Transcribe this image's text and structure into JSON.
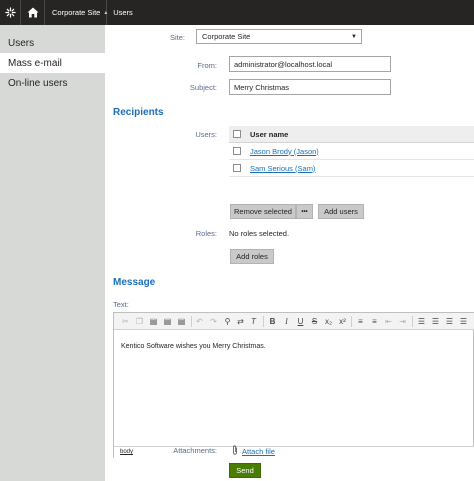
{
  "topbar": {
    "site_selector": "Corporate Site",
    "app_name": "Users"
  },
  "sidebar": {
    "items": [
      {
        "label": "Users"
      },
      {
        "label": "Mass e-mail"
      },
      {
        "label": "On-line users"
      }
    ],
    "active_index": 1
  },
  "form": {
    "site_label": "Site:",
    "site_value": "Corporate Site",
    "from_label": "From:",
    "from_value": "administrator@localhost.local",
    "subject_label": "Subject:",
    "subject_value": "Merry Christmas"
  },
  "recipients": {
    "heading": "Recipients",
    "users_label": "Users:",
    "table_header": "User name",
    "users": [
      {
        "name": "Jason Brody (Jason)"
      },
      {
        "name": "Sam Serious (Sam)"
      }
    ],
    "remove_selected": "Remove selected",
    "more_glyph": "•••",
    "add_users": "Add users",
    "roles_label": "Roles:",
    "roles_value": "No roles selected.",
    "add_roles": "Add roles"
  },
  "message": {
    "heading": "Message",
    "text_label": "Text:",
    "body_text": "Kentico Software wishes you Merry Christmas.",
    "path_label": "body",
    "toolbar_icons": [
      "cut-icon",
      "copy-icon",
      "paste-icon",
      "paste-text-icon",
      "paste-word-icon",
      "undo-icon",
      "redo-icon",
      "find-icon",
      "replace-icon",
      "remove-format-icon",
      "bold-icon",
      "italic-icon",
      "underline-icon",
      "strikethrough-icon",
      "subscript-icon",
      "superscript-icon",
      "numbered-list-icon",
      "bulleted-list-icon",
      "outdent-icon",
      "indent-icon",
      "align-left-icon",
      "align-center-icon",
      "align-right-icon",
      "justify-icon"
    ]
  },
  "attachments_label": "Attachments:",
  "attach_file": "Attach file",
  "send_button": "Send",
  "colors": {
    "topbar": "#262524",
    "sidebar": "#d6d9d6",
    "heading_blue": "#1b6fb6",
    "label_gray": "#596b8a",
    "send_green": "#497d04"
  }
}
